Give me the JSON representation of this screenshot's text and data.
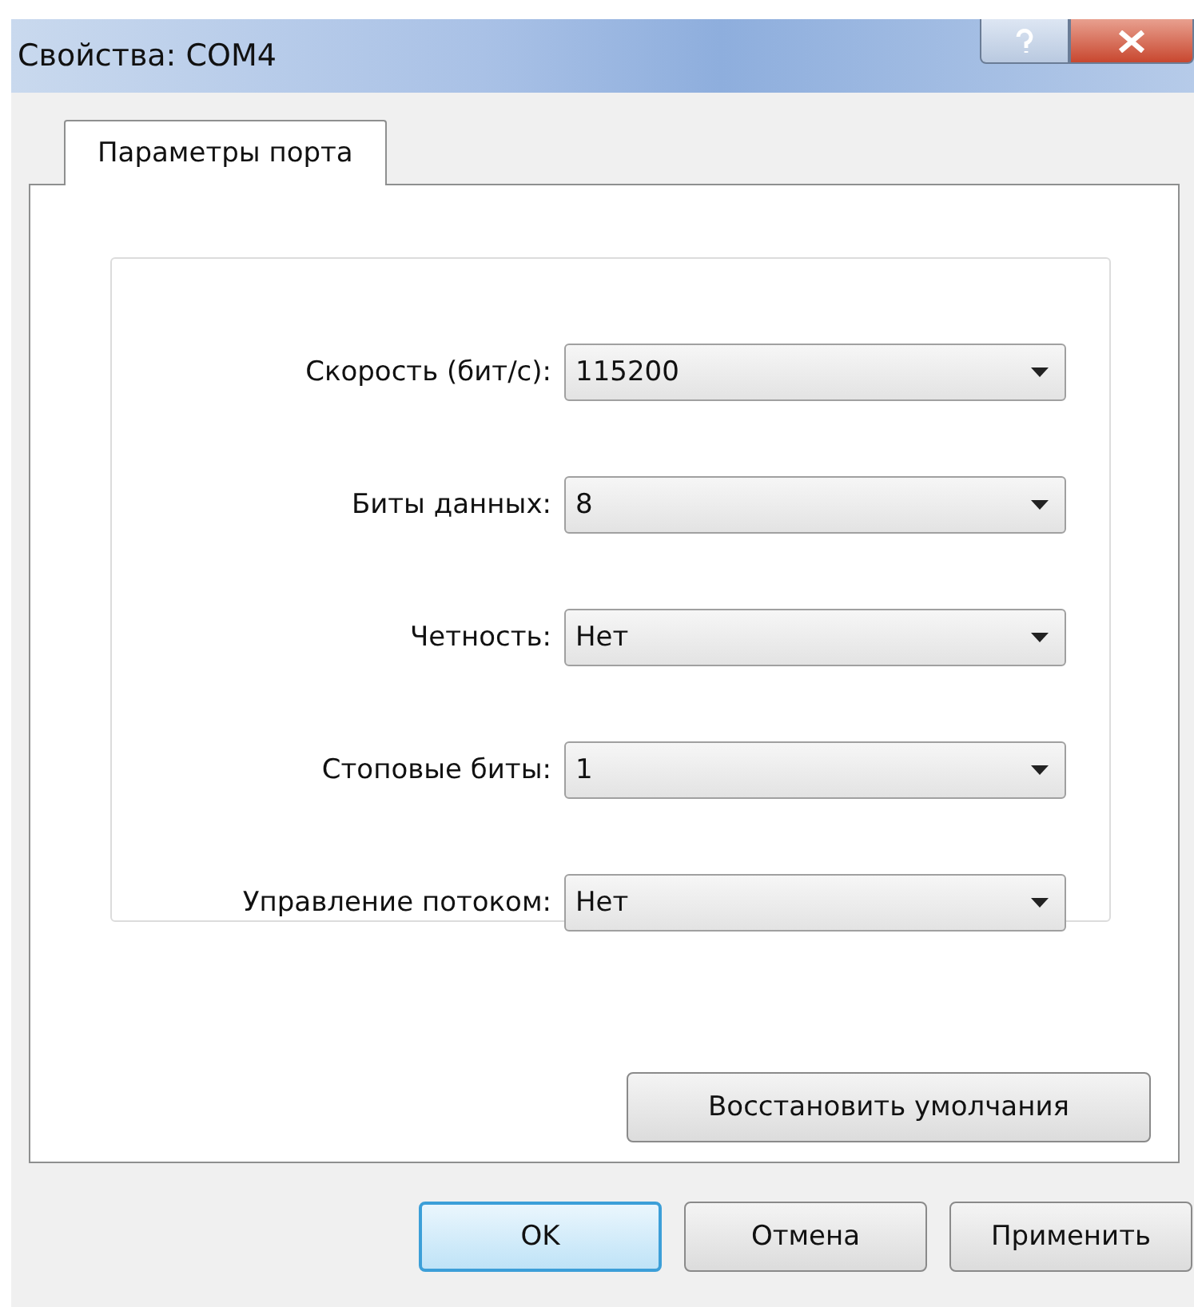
{
  "window": {
    "title": "Свойства: COM4"
  },
  "tabs": [
    {
      "label": "Параметры порта",
      "selected": true
    }
  ],
  "settings": [
    {
      "label": "Скорость (бит/с):",
      "value": "115200"
    },
    {
      "label": "Биты данных:",
      "value": "8"
    },
    {
      "label": "Четность:",
      "value": "Нет"
    },
    {
      "label": "Стоповые биты:",
      "value": "1"
    },
    {
      "label": "Управление потоком:",
      "value": "Нет"
    }
  ],
  "restore_button": "Восстановить умолчания",
  "buttons": [
    {
      "label": "OK",
      "default": true
    },
    {
      "label": "Отмена",
      "default": false
    },
    {
      "label": "Применить",
      "default": false
    }
  ]
}
